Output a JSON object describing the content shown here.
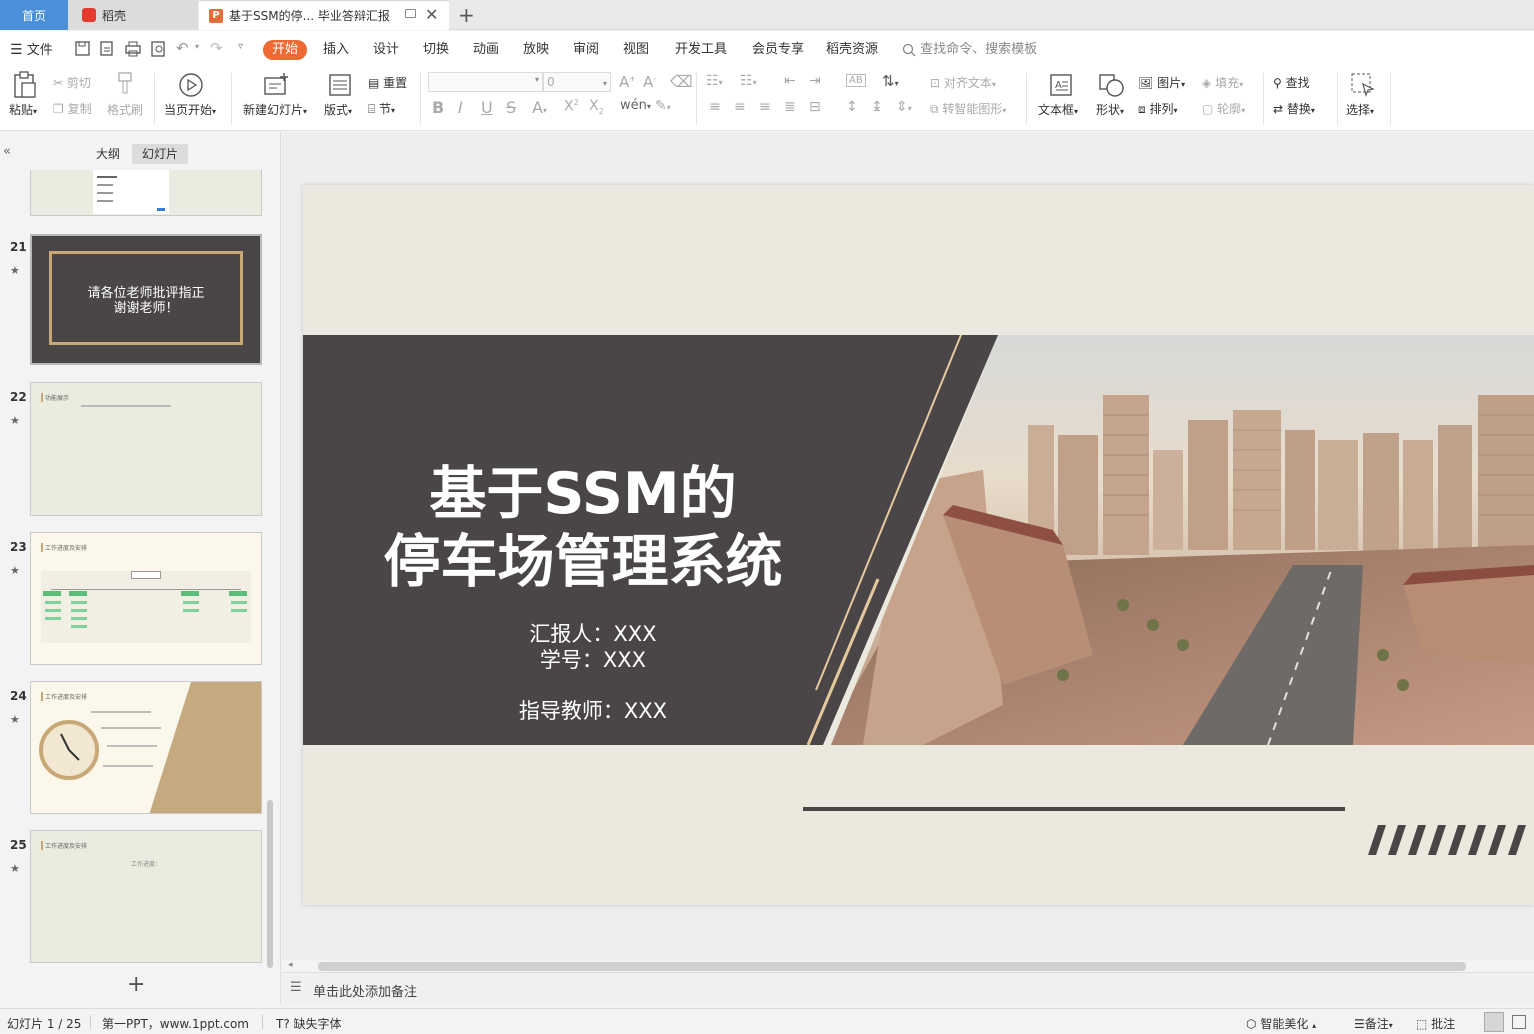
{
  "tabs": {
    "home": "首页",
    "daoke": "稻壳",
    "doc": "基于SSM的停... 毕业答辩汇报",
    "new_tab": "+"
  },
  "menubar": {
    "file": "文件",
    "items": [
      "开始",
      "插入",
      "设计",
      "切换",
      "动画",
      "放映",
      "审阅",
      "视图",
      "开发工具",
      "会员专享",
      "稻壳资源"
    ],
    "search_placeholder": "查找命令、搜索模板"
  },
  "ribbon": {
    "paste": "粘贴",
    "cut": "剪切",
    "copy": "复制",
    "format_painter": "格式刷",
    "from_current": "当页开始",
    "new_slide": "新建幻灯片",
    "layout": "版式",
    "reset": "重置",
    "section": "节",
    "font_size": "0",
    "align_text": "对齐文本",
    "smart_graphic": "转智能图形",
    "textbox": "文本框",
    "shape": "形状",
    "picture": "图片",
    "arrange": "排列",
    "fill": "填充",
    "outline": "轮廓",
    "find": "查找",
    "replace": "替换",
    "select": "选择"
  },
  "leftpanel": {
    "tab_outline": "大纲",
    "tab_slides": "幻灯片",
    "thumbs": [
      {
        "num": "21",
        "text": "请各位老师批评指正\n谢谢老师！"
      },
      {
        "num": "22",
        "title": "功能展示"
      },
      {
        "num": "23",
        "title": "工作进度及安排"
      },
      {
        "num": "24",
        "title": "工作进度及安排"
      },
      {
        "num": "25",
        "title": "工作进度及安排",
        "text": "工作进度："
      }
    ],
    "add": "+"
  },
  "slide": {
    "title_line1": "基于SSM的",
    "title_line2": "停车场管理系统",
    "reporter": "汇报人：XXX",
    "student_id": "学号：XXX",
    "advisor": "指导教师：XXX"
  },
  "notes": {
    "placeholder": "单击此处添加备注"
  },
  "statusbar": {
    "slide_count": "幻灯片 1 / 25",
    "theme": "第一PPT，www.1ppt.com",
    "missing_font": "缺失字体",
    "beautify": "智能美化",
    "notes": "备注",
    "comment": "批注"
  },
  "colors": {
    "accent": "#ee6a33",
    "home_tab": "#4a90d9",
    "slide_bg": "#ebe8de",
    "slide_dark": "#4a4648",
    "gold": "#c9a878"
  }
}
